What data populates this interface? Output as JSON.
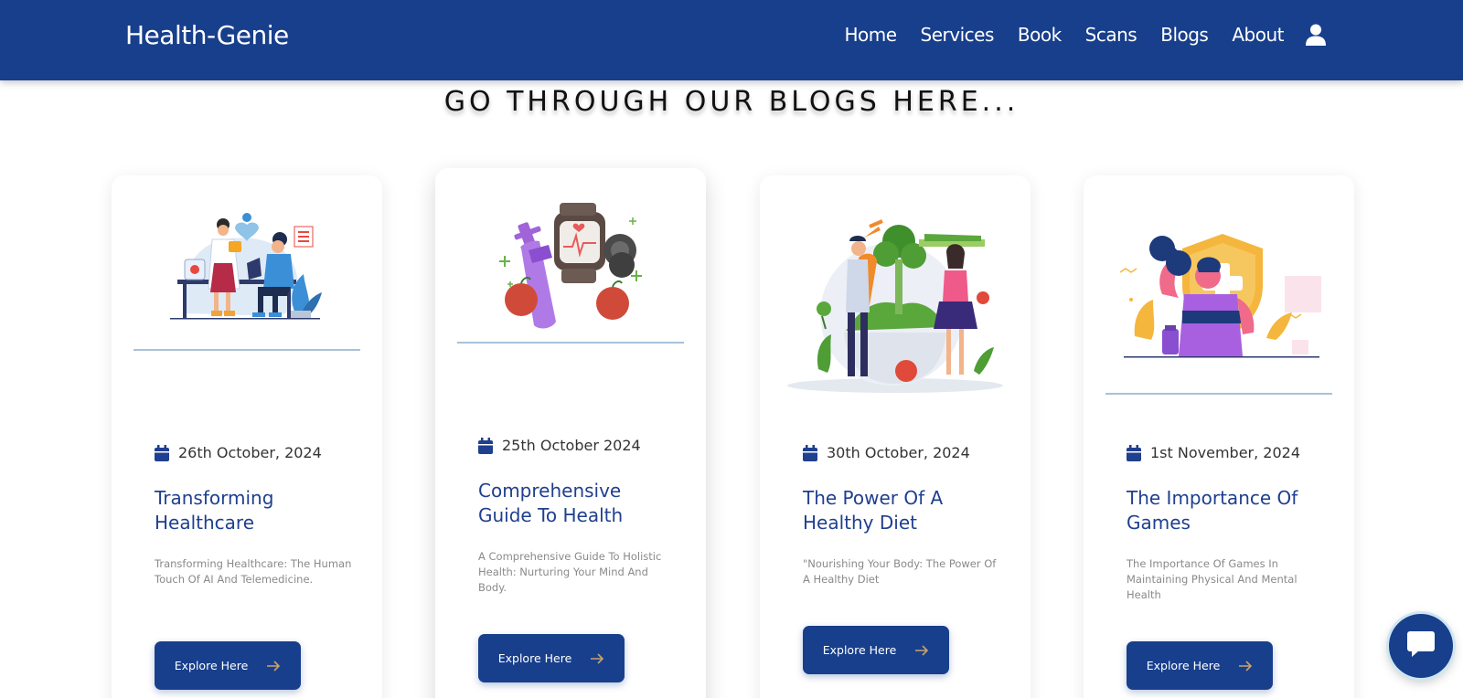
{
  "brand": "Health-Genie",
  "nav": {
    "home": "Home",
    "services": "Services",
    "book": "Book",
    "scans": "Scans",
    "blogs": "Blogs",
    "about": "About",
    "user_icon": "user-icon"
  },
  "section_title": "GO THROUGH OUR BLOGS HERE...",
  "blogs": [
    {
      "date": "26th October, 2024",
      "title": "Transforming Healthcare",
      "description": "Transforming Healthcare: The Human Touch Of AI And Telemedicine.",
      "button": "Explore Here",
      "image": "doctor-consultation-illustration"
    },
    {
      "date": "25th October 2024",
      "title": "Comprehensive Guide To Health",
      "description": "A Comprehensive Guide To Holistic Health: Nurturing Your Mind And Body.",
      "button": "Explore Here",
      "image": "fitness-items-illustration"
    },
    {
      "date": "30th October, 2024",
      "title": "The Power Of A Healthy Diet",
      "description": "\"Nourishing Your Body: The Power Of A Healthy Diet",
      "button": "Explore Here",
      "image": "healthy-diet-illustration"
    },
    {
      "date": "1st November, 2024",
      "title": "The Importance Of Games",
      "description": "The Importance Of Games In Maintaining Physical And Mental Health",
      "button": "Explore Here",
      "image": "strength-health-illustration"
    }
  ],
  "colors": {
    "primary": "#183f8c",
    "title_blue": "#1f3f8f",
    "divider": "#a9c1d9",
    "arrow": "#c9a36a"
  },
  "chat": {
    "icon": "chat-bubble-icon"
  }
}
